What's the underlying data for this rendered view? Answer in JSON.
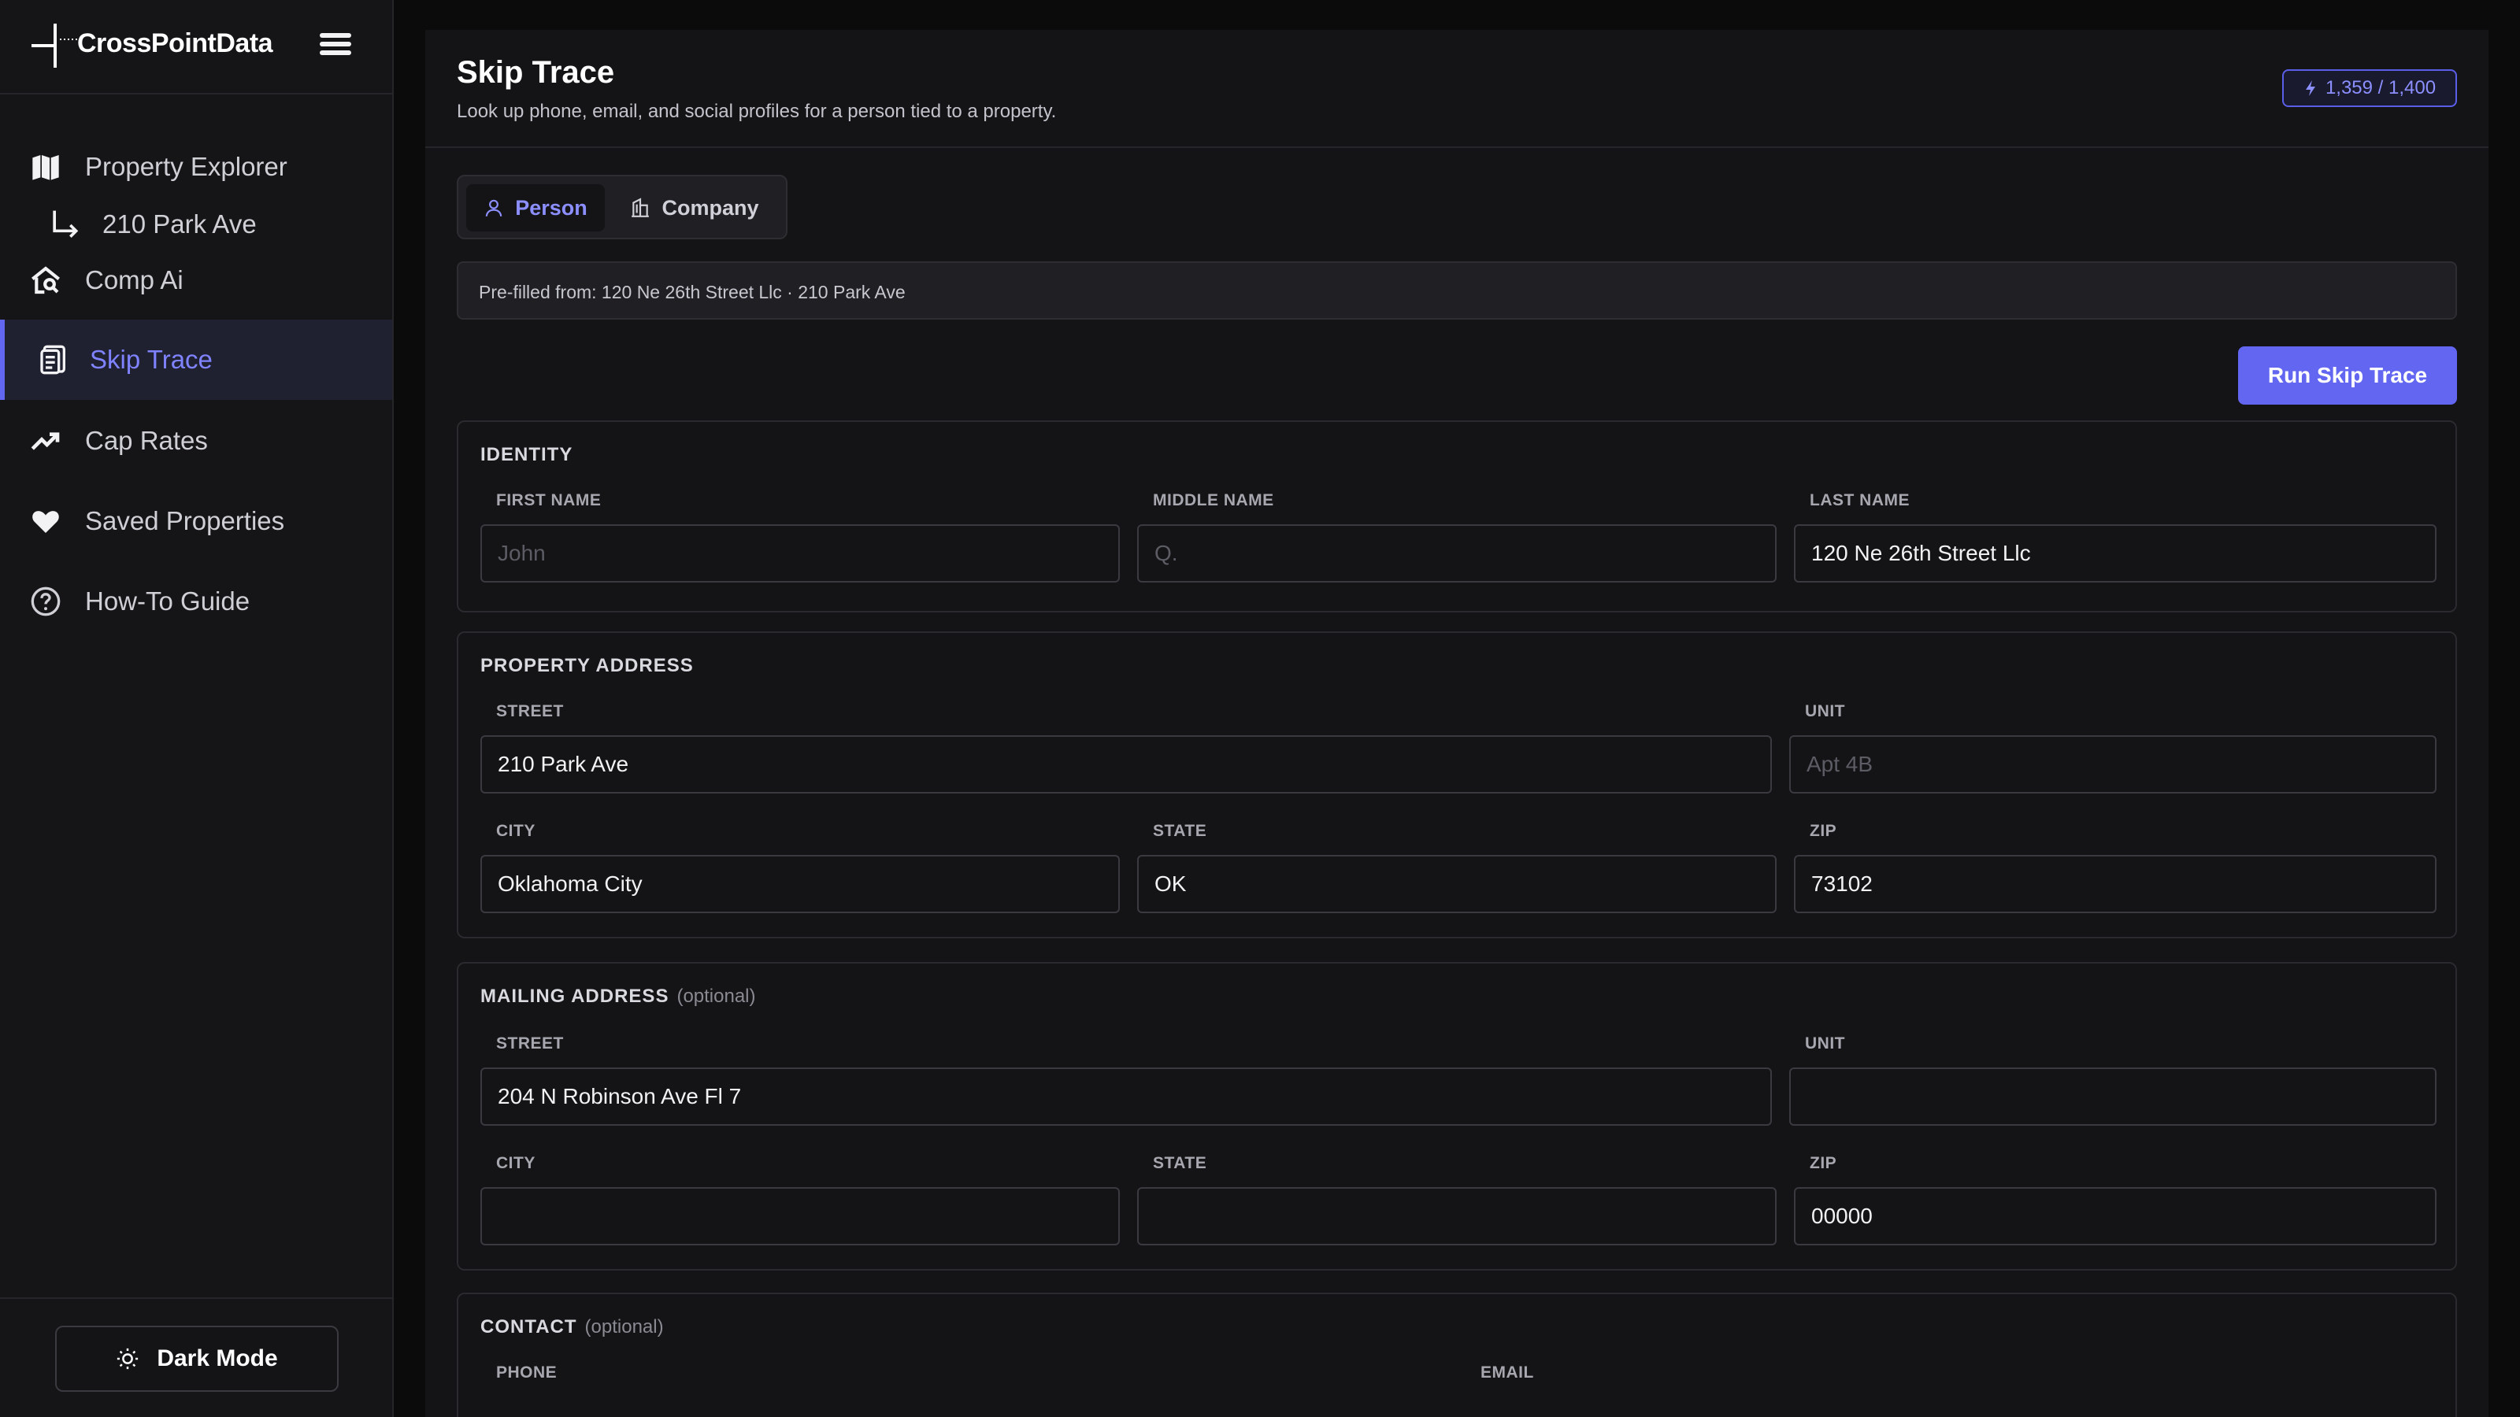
{
  "app": {
    "name": "CrossPointData"
  },
  "sidebar": {
    "items": [
      {
        "label": "Property Explorer",
        "icon": "map-icon"
      },
      {
        "label": "210 Park Ave",
        "icon": "subdirectory-arrow-icon"
      },
      {
        "label": "Comp Ai",
        "icon": "house-search-icon"
      },
      {
        "label": "Skip Trace",
        "icon": "document-icon",
        "active": true
      },
      {
        "label": "Cap Rates",
        "icon": "trending-up-icon"
      },
      {
        "label": "Saved Properties",
        "icon": "heart-icon"
      },
      {
        "label": "How-To Guide",
        "icon": "help-circle-icon"
      }
    ],
    "footer": {
      "dark_mode_label": "Dark Mode",
      "icon": "sun-icon"
    }
  },
  "header": {
    "title": "Skip Trace",
    "subtitle": "Look up phone, email, and social profiles for a person tied to a property.",
    "credits": "1,359 / 1,400"
  },
  "tabs": {
    "person": "Person",
    "company": "Company",
    "selected": "Person"
  },
  "prefill": "Pre-filled from: 120 Ne 26th Street Llc · 210 Park Ave",
  "run_button": "Run Skip Trace",
  "identity": {
    "title": "IDENTITY",
    "first_name": {
      "label": "FIRST NAME",
      "value": "",
      "placeholder": "John"
    },
    "middle_name": {
      "label": "MIDDLE NAME",
      "value": "",
      "placeholder": "Q."
    },
    "last_name": {
      "label": "LAST NAME",
      "value": "120 Ne 26th Street Llc",
      "placeholder": ""
    }
  },
  "property_address": {
    "title": "PROPERTY ADDRESS",
    "street": {
      "label": "STREET",
      "value": "210 Park Ave"
    },
    "unit": {
      "label": "UNIT",
      "value": "",
      "placeholder": "Apt 4B"
    },
    "city": {
      "label": "CITY",
      "value": "Oklahoma City"
    },
    "state": {
      "label": "STATE",
      "value": "OK"
    },
    "zip": {
      "label": "ZIP",
      "value": "73102"
    }
  },
  "mailing_address": {
    "title": "MAILING ADDRESS",
    "optional": "(optional)",
    "street": {
      "label": "STREET",
      "value": "204 N Robinson Ave Fl 7"
    },
    "unit": {
      "label": "UNIT",
      "value": ""
    },
    "city": {
      "label": "CITY",
      "value": ""
    },
    "state": {
      "label": "STATE",
      "value": ""
    },
    "zip": {
      "label": "ZIP",
      "value": "00000"
    }
  },
  "contact": {
    "title": "CONTACT",
    "optional": "(optional)",
    "phone_label": "PHONE",
    "email_label": "EMAIL"
  },
  "colors": {
    "accent": "#6366f1",
    "accent_text": "#7f83ff",
    "background": "#0b0b0c",
    "panel": "#141416"
  }
}
